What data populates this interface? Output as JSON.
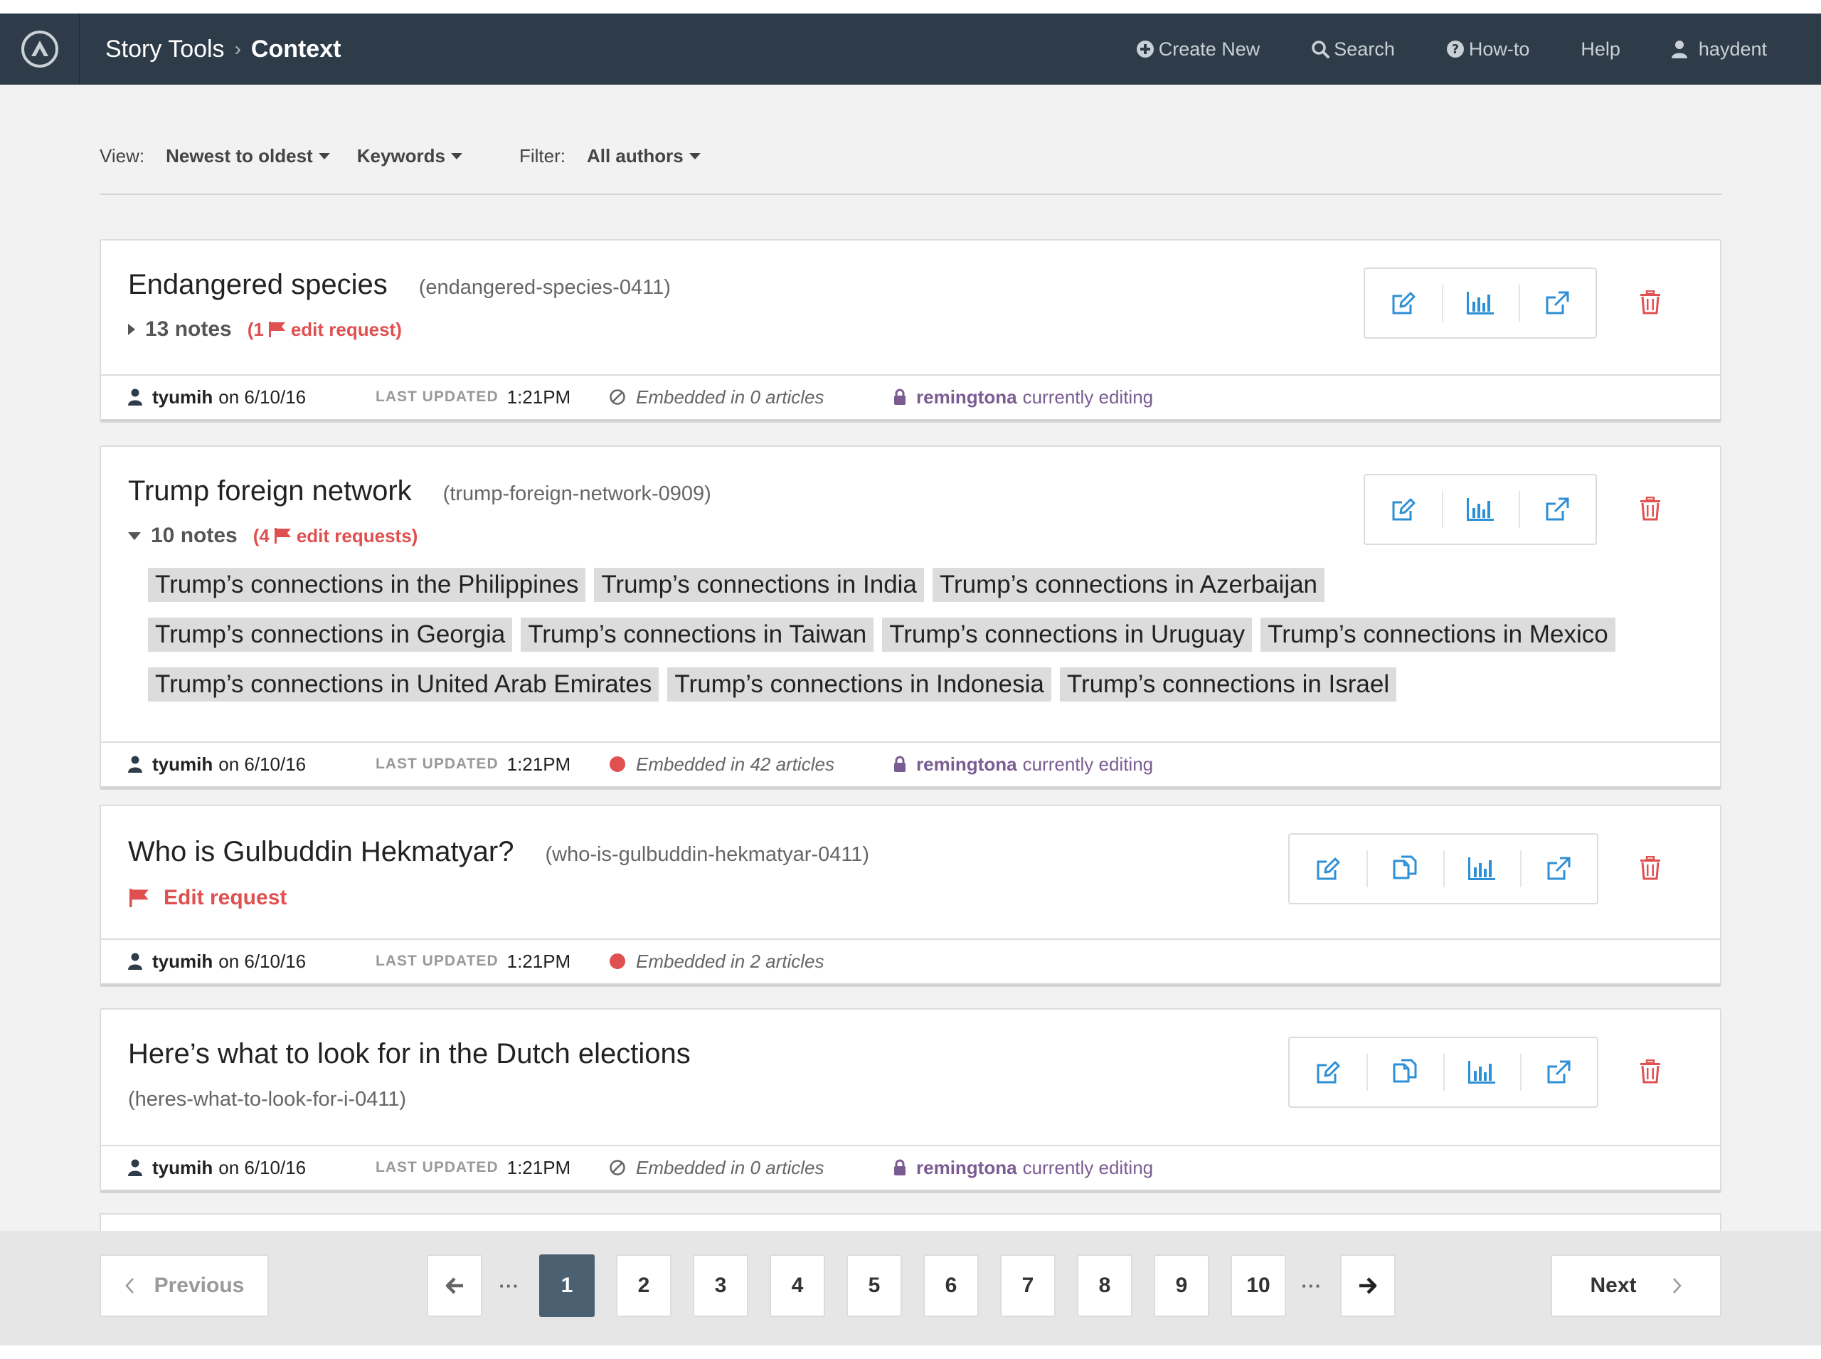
{
  "nav": {
    "breadcrumb_parent": "Story Tools",
    "breadcrumb_separator": "›",
    "breadcrumb_current": "Context",
    "create_new": "Create New",
    "search": "Search",
    "howto": "How-to",
    "help": "Help",
    "user": "haydent"
  },
  "filters": {
    "view_label": "View:",
    "sort": "Newest to oldest",
    "keywords": "Keywords",
    "filter_label": "Filter:",
    "authors": "All authors"
  },
  "cards": [
    {
      "title": "Endangered species",
      "slug": "(endangered-species-0411)",
      "notes": "13 notes",
      "edit_pre": "(1",
      "edit_post": "edit request)",
      "author": "tyumih",
      "date_text": "on 6/10/16",
      "updated_label": "LAST UPDATED",
      "updated_time": "1:21PM",
      "embedded": "Embedded in 0 articles",
      "editor": "remingtona",
      "editing_text": "currently editing"
    },
    {
      "title": "Trump foreign network",
      "slug": "(trump-foreign-network-0909)",
      "notes": "10 notes",
      "edit_pre": "(4",
      "edit_post": "edit requests)",
      "tags": [
        "Trump’s connections in the Philippines",
        "Trump’s connections in India",
        "Trump’s connections in Azerbaijan",
        "Trump’s connections in Georgia",
        "Trump’s connections in Taiwan",
        "Trump’s connections in Uruguay",
        "Trump’s connections in Mexico",
        "Trump’s connections in United Arab Emirates",
        "Trump’s connections in Indonesia",
        "Trump’s connections in Israel"
      ],
      "author": "tyumih",
      "date_text": "on 6/10/16",
      "updated_label": "LAST UPDATED",
      "updated_time": "1:21PM",
      "embedded": "Embedded in 42 articles",
      "editor": "remingtona",
      "editing_text": "currently editing"
    },
    {
      "title": "Who is Gulbuddin Hekmatyar?",
      "slug": "(who-is-gulbuddin-hekmatyar-0411)",
      "edit_request": "Edit request",
      "author": "tyumih",
      "date_text": "on 6/10/16",
      "updated_label": "LAST UPDATED",
      "updated_time": "1:21PM",
      "embedded": "Embedded in 2 articles"
    },
    {
      "title": "Here’s what to look for in the Dutch elections",
      "slug": "(heres-what-to-look-for-i-0411)",
      "author": "tyumih",
      "date_text": "on 6/10/16",
      "updated_label": "LAST UPDATED",
      "updated_time": "1:21PM",
      "embedded": "Embedded in 0 articles",
      "editor": "remingtona",
      "editing_text": "currently editing"
    }
  ],
  "pagination": {
    "previous": "Previous",
    "next": "Next",
    "ellipsis": "···",
    "pages": [
      "1",
      "2",
      "3",
      "4",
      "5",
      "6",
      "7",
      "8",
      "9",
      "10"
    ],
    "current": "1"
  },
  "colors": {
    "nav_bg": "#2d3c48",
    "action_blue": "#2d8fd5",
    "danger_red": "#e05050",
    "editing_purple": "#7a5c93",
    "active_page": "#4b6070"
  },
  "icons": {
    "logo": "logo-icon",
    "create": "plus-circle-icon",
    "search": "search-icon",
    "howto": "question-circle-icon",
    "user": "user-icon",
    "edit": "edit-icon",
    "copy": "copy-icon",
    "stats": "bar-chart-icon",
    "open": "external-link-icon",
    "delete": "trash-icon",
    "flag": "flag-icon",
    "embedded_none": "ban-icon",
    "embedded_live": "red-dot-icon",
    "lock": "lock-icon",
    "arrow_left": "arrow-left-icon",
    "arrow_right": "arrow-right-icon"
  }
}
